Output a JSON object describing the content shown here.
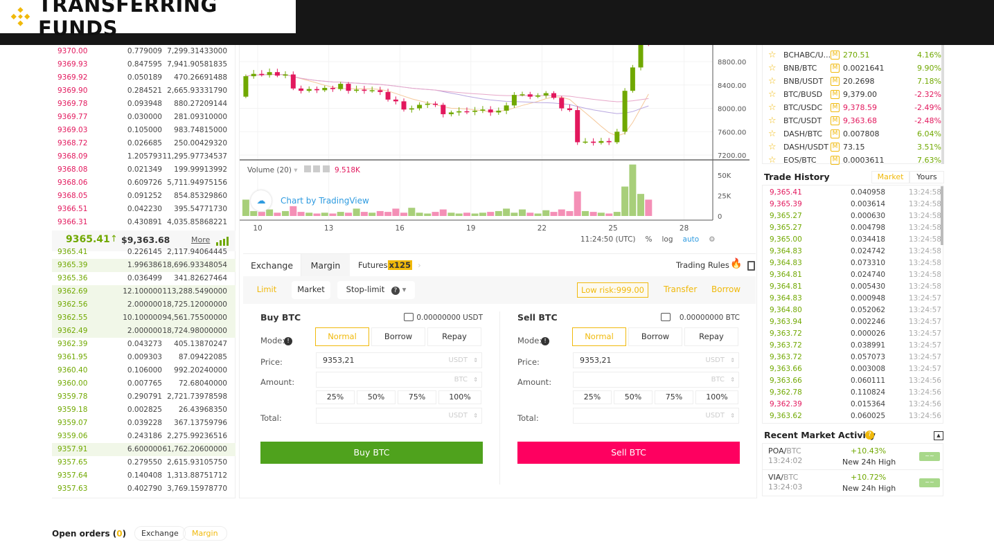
{
  "banner": {
    "title": "TRANSFERRING FUNDS",
    "brand_color": "#f0b90b"
  },
  "orderbook": {
    "asks": [
      {
        "price": "9370.00",
        "amount": "0.779009",
        "total": "7,299.31433000"
      },
      {
        "price": "9369.93",
        "amount": "0.847595",
        "total": "7,941.90581835"
      },
      {
        "price": "9369.92",
        "amount": "0.050189",
        "total": "470.26691488"
      },
      {
        "price": "9369.90",
        "amount": "0.284521",
        "total": "2,665.93331790"
      },
      {
        "price": "9369.78",
        "amount": "0.093948",
        "total": "880.27209144"
      },
      {
        "price": "9369.77",
        "amount": "0.030000",
        "total": "281.09310000"
      },
      {
        "price": "9369.03",
        "amount": "0.105000",
        "total": "983.74815000"
      },
      {
        "price": "9368.72",
        "amount": "0.026685",
        "total": "250.00429320"
      },
      {
        "price": "9368.09",
        "amount": "1.205793",
        "total": "11,295.97734537"
      },
      {
        "price": "9368.08",
        "amount": "0.021349",
        "total": "199.99913992"
      },
      {
        "price": "9368.06",
        "amount": "0.609726",
        "total": "5,711.94975156"
      },
      {
        "price": "9368.05",
        "amount": "0.091252",
        "total": "854.85329860"
      },
      {
        "price": "9366.51",
        "amount": "0.042230",
        "total": "395.54771730"
      },
      {
        "price": "9366.31",
        "amount": "0.430891",
        "total": "4,035.85868221"
      }
    ],
    "last_price": "9365.41",
    "last_arrow": "↑",
    "last_usd": "$9,363.68",
    "more_label": "More",
    "bids": [
      {
        "price": "9365.41",
        "amount": "0.226145",
        "total": "2,117.94064445"
      },
      {
        "price": "9365.39",
        "amount": "1.996386",
        "total": "18,696.93348054"
      },
      {
        "price": "9365.36",
        "amount": "0.036499",
        "total": "341.82627464"
      },
      {
        "price": "9362.69",
        "amount": "12.100000",
        "total": "113,288.5490000"
      },
      {
        "price": "9362.56",
        "amount": "2.000000",
        "total": "18,725.12000000"
      },
      {
        "price": "9362.55",
        "amount": "10.100000",
        "total": "94,561.75500000"
      },
      {
        "price": "9362.49",
        "amount": "2.000000",
        "total": "18,724.98000000"
      },
      {
        "price": "9362.39",
        "amount": "0.043273",
        "total": "405.13870247"
      },
      {
        "price": "9361.95",
        "amount": "0.009303",
        "total": "87.09422085"
      },
      {
        "price": "9360.40",
        "amount": "0.106000",
        "total": "992.20240000"
      },
      {
        "price": "9360.00",
        "amount": "0.007765",
        "total": "72.68040000"
      },
      {
        "price": "9359.78",
        "amount": "0.290791",
        "total": "2,721.73978598"
      },
      {
        "price": "9359.18",
        "amount": "0.002825",
        "total": "26.43968350"
      },
      {
        "price": "9359.07",
        "amount": "0.039228",
        "total": "367.13759796"
      },
      {
        "price": "9359.06",
        "amount": "0.243186",
        "total": "2,275.99236516"
      },
      {
        "price": "9357.91",
        "amount": "6.600000",
        "total": "61,762.20600000"
      },
      {
        "price": "9357.65",
        "amount": "0.279550",
        "total": "2,615.93105750"
      },
      {
        "price": "9357.64",
        "amount": "0.140408",
        "total": "1,313.88751712"
      },
      {
        "price": "9357.63",
        "amount": "0.402790",
        "total": "3,769.15978770"
      }
    ]
  },
  "chart_data": {
    "type": "candlestick",
    "x_ticks": [
      "10",
      "13",
      "16",
      "19",
      "22",
      "25",
      "28"
    ],
    "y_ticks": [
      "8800.00",
      "8400.00",
      "8000.00",
      "7600.00",
      "7200.00"
    ],
    "ylim": [
      7130,
      9085
    ],
    "x_days": [
      9.5,
      9.83,
      10.17,
      10.5,
      10.83,
      11.17,
      11.5,
      11.83,
      12.17,
      12.5,
      12.83,
      13.17,
      13.5,
      13.83,
      14.17,
      14.5,
      14.83,
      15.17,
      15.5,
      15.83,
      16.17,
      16.5,
      16.83,
      17.17,
      17.5,
      17.83,
      18.17,
      18.5,
      18.83,
      19.17,
      19.5,
      19.83,
      20.17,
      20.5,
      20.83,
      21.17,
      21.5,
      21.83,
      22.17,
      22.5,
      22.83,
      23.17,
      23.5,
      23.83,
      24.17,
      24.5,
      24.83,
      25.17,
      25.5,
      25.83,
      26.17,
      26.5
    ],
    "open_first": 8200,
    "close": [
      8550,
      8590,
      8570,
      8620,
      8560,
      8580,
      8340,
      8300,
      8330,
      8310,
      8350,
      8330,
      8420,
      8300,
      8320,
      8300,
      8310,
      8280,
      8150,
      8120,
      7980,
      8000,
      8060,
      8080,
      8060,
      7900,
      7930,
      7950,
      7940,
      7960,
      7980,
      7930,
      7960,
      8050,
      8230,
      8240,
      8200,
      8220,
      8260,
      8180,
      8000,
      7970,
      7420,
      7430,
      7410,
      7440,
      7420,
      7600,
      8300,
      8700,
      9150,
      9100
    ],
    "volume_k": [
      20,
      6,
      5,
      8,
      4,
      6,
      12,
      5,
      4,
      3,
      4,
      3,
      5,
      4,
      9,
      5,
      4,
      6,
      5,
      9,
      4,
      10,
      4,
      3,
      5,
      8,
      4,
      3,
      4,
      3,
      4,
      5,
      6,
      9,
      4,
      8,
      4,
      3,
      7,
      5,
      8,
      6,
      30,
      6,
      5,
      4,
      3,
      5,
      36,
      63,
      27,
      20
    ],
    "volume_ticks": [
      "50K",
      "25K",
      "0"
    ],
    "volume_label": "Volume (20)",
    "volume_value": "9.518K",
    "watermark": "Chart by TradingView",
    "time": "11:24:50 (UTC)",
    "toolbar": [
      "%",
      "log",
      "auto"
    ],
    "up_color": "#70a800",
    "down_color": "#e2185d"
  },
  "trade": {
    "tabs": [
      "Exchange",
      "Margin",
      "Futures"
    ],
    "futures_badge": "x125",
    "trading_rules": "Trading Rules",
    "order_types": [
      "Limit",
      "Market",
      "Stop-limit"
    ],
    "risk": "Low risk:999.00",
    "transfer": "Transfer",
    "borrow": "Borrow",
    "buy": {
      "title": "Buy BTC",
      "balance": "0.00000000 USDT",
      "mode_label": "Mode:",
      "modes": [
        "Normal",
        "Borrow",
        "Repay"
      ],
      "price_label": "Price:",
      "price_value": "9353,21",
      "price_unit": "USDT",
      "amount_label": "Amount:",
      "amount_unit": "BTC",
      "total_label": "Total:",
      "total_unit": "USDT",
      "percents": [
        "25%",
        "50%",
        "75%",
        "100%"
      ],
      "button": "Buy BTC"
    },
    "sell": {
      "title": "Sell BTC",
      "balance": "0.00000000 BTC",
      "mode_label": "Mode:",
      "modes": [
        "Normal",
        "Borrow",
        "Repay"
      ],
      "price_label": "Price:",
      "price_value": "9353,21",
      "price_unit": "USDT",
      "amount_label": "Amount:",
      "amount_unit": "BTC",
      "total_label": "Total:",
      "total_unit": "USDT",
      "percents": [
        "25%",
        "50%",
        "75%",
        "100%"
      ],
      "button": "Sell BTC"
    }
  },
  "markets": [
    {
      "symbol": "BCHABC/U...",
      "price": "270.51",
      "change": "4.16%",
      "dir": "up"
    },
    {
      "symbol": "BNB/BTC",
      "price": "0.0021641",
      "change": "9.90%",
      "dir": "flat"
    },
    {
      "symbol": "BNB/USDT",
      "price": "20.2698",
      "change": "7.18%",
      "dir": "flat"
    },
    {
      "symbol": "BTC/BUSD",
      "price": "9,379.00",
      "change": "-2.32%",
      "dir": "flat"
    },
    {
      "symbol": "BTC/USDC",
      "price": "9,378.59",
      "change": "-2.49%",
      "dir": "down"
    },
    {
      "symbol": "BTC/USDT",
      "price": "9,363.68",
      "change": "-2.48%",
      "dir": "down"
    },
    {
      "symbol": "DASH/BTC",
      "price": "0.007808",
      "change": "6.04%",
      "dir": "flat"
    },
    {
      "symbol": "DASH/USDT",
      "price": "73.15",
      "change": "3.51%",
      "dir": "flat"
    },
    {
      "symbol": "EOS/BTC",
      "price": "0.0003611",
      "change": "7.63%",
      "dir": "flat"
    }
  ],
  "trade_history": {
    "title": "Trade History",
    "tabs": [
      "Market",
      "Yours"
    ],
    "rows": [
      {
        "price": "9,365.41",
        "amount": "0.040958",
        "time": "13:24:58",
        "side": "sell"
      },
      {
        "price": "9,365.39",
        "amount": "0.003614",
        "time": "13:24:58",
        "side": "sell"
      },
      {
        "price": "9,365.27",
        "amount": "0.000630",
        "time": "13:24:58",
        "side": "buy"
      },
      {
        "price": "9,365.27",
        "amount": "0.004798",
        "time": "13:24:58",
        "side": "buy"
      },
      {
        "price": "9,365.00",
        "amount": "0.034418",
        "time": "13:24:58",
        "side": "buy"
      },
      {
        "price": "9,364.83",
        "amount": "0.024742",
        "time": "13:24:58",
        "side": "buy"
      },
      {
        "price": "9,364.83",
        "amount": "0.073310",
        "time": "13:24:58",
        "side": "buy"
      },
      {
        "price": "9,364.81",
        "amount": "0.024740",
        "time": "13:24:58",
        "side": "buy"
      },
      {
        "price": "9,364.81",
        "amount": "0.005430",
        "time": "13:24:58",
        "side": "buy"
      },
      {
        "price": "9,364.83",
        "amount": "0.000948",
        "time": "13:24:57",
        "side": "buy"
      },
      {
        "price": "9,364.80",
        "amount": "0.052062",
        "time": "13:24:57",
        "side": "buy"
      },
      {
        "price": "9,363.94",
        "amount": "0.002246",
        "time": "13:24:57",
        "side": "buy"
      },
      {
        "price": "9,363.72",
        "amount": "0.000026",
        "time": "13:24:57",
        "side": "buy"
      },
      {
        "price": "9,363.72",
        "amount": "0.038991",
        "time": "13:24:57",
        "side": "buy"
      },
      {
        "price": "9,363.72",
        "amount": "0.057073",
        "time": "13:24:57",
        "side": "buy"
      },
      {
        "price": "9,363.66",
        "amount": "0.003008",
        "time": "13:24:57",
        "side": "buy"
      },
      {
        "price": "9,363.66",
        "amount": "0.060111",
        "time": "13:24:56",
        "side": "buy"
      },
      {
        "price": "9,362.78",
        "amount": "0.110824",
        "time": "13:24:56",
        "side": "buy"
      },
      {
        "price": "9,362.39",
        "amount": "0.015364",
        "time": "13:24:56",
        "side": "sell"
      },
      {
        "price": "9,363.62",
        "amount": "0.060025",
        "time": "13:24:56",
        "side": "buy"
      }
    ]
  },
  "activity": {
    "title": "Recent Market Activity",
    "rows": [
      {
        "base": "POA/",
        "quote": "BTC",
        "time": "13:24:02",
        "change": "+10.43%",
        "desc": "New 24h High"
      },
      {
        "base": "VIA/",
        "quote": "BTC",
        "time": "13:24:03",
        "change": "+10.72%",
        "desc": "New 24h High"
      }
    ]
  },
  "open_orders": {
    "label": "Open orders (",
    "count": "0",
    "close": ")",
    "tabs": [
      "Exchange",
      "Margin"
    ]
  }
}
